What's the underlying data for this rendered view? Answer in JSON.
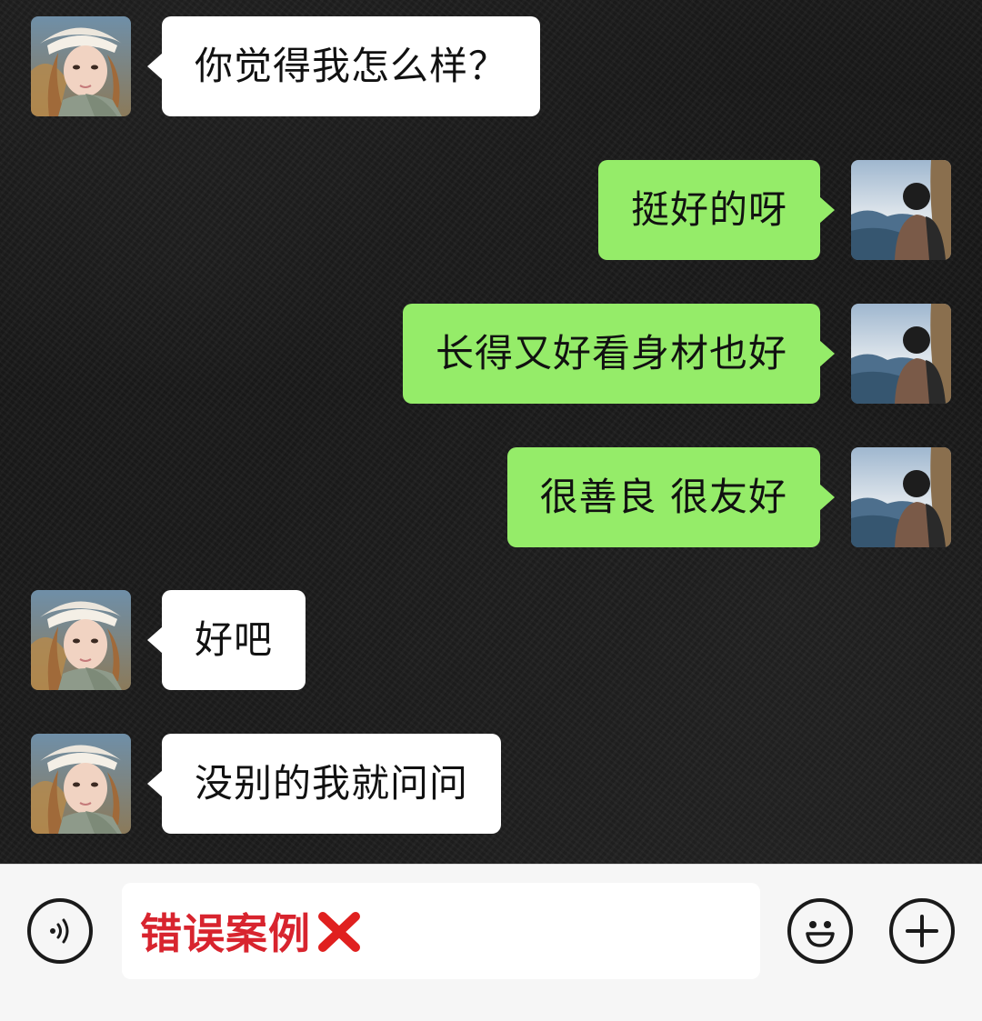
{
  "messages": [
    {
      "id": "m1",
      "side": "left",
      "text": "你觉得我怎么样？"
    },
    {
      "id": "m2",
      "side": "right",
      "text": "挺好的呀"
    },
    {
      "id": "m3",
      "side": "right",
      "text": "长得又好看身材也好"
    },
    {
      "id": "m4",
      "side": "right",
      "text": "很善良 很友好"
    },
    {
      "id": "m5",
      "side": "left",
      "text": "好吧"
    },
    {
      "id": "m6",
      "side": "left",
      "text": "没别的我就问问"
    }
  ],
  "input": {
    "text": "错误案例"
  },
  "icons": {
    "voice": "voice-icon",
    "emoji": "emoji-icon",
    "plus": "plus-icon",
    "cross": "red-cross-icon"
  },
  "colors": {
    "sent_bubble": "#95ec69",
    "received_bubble": "#ffffff",
    "input_text": "#d8242e",
    "cross": "#e0201f"
  }
}
